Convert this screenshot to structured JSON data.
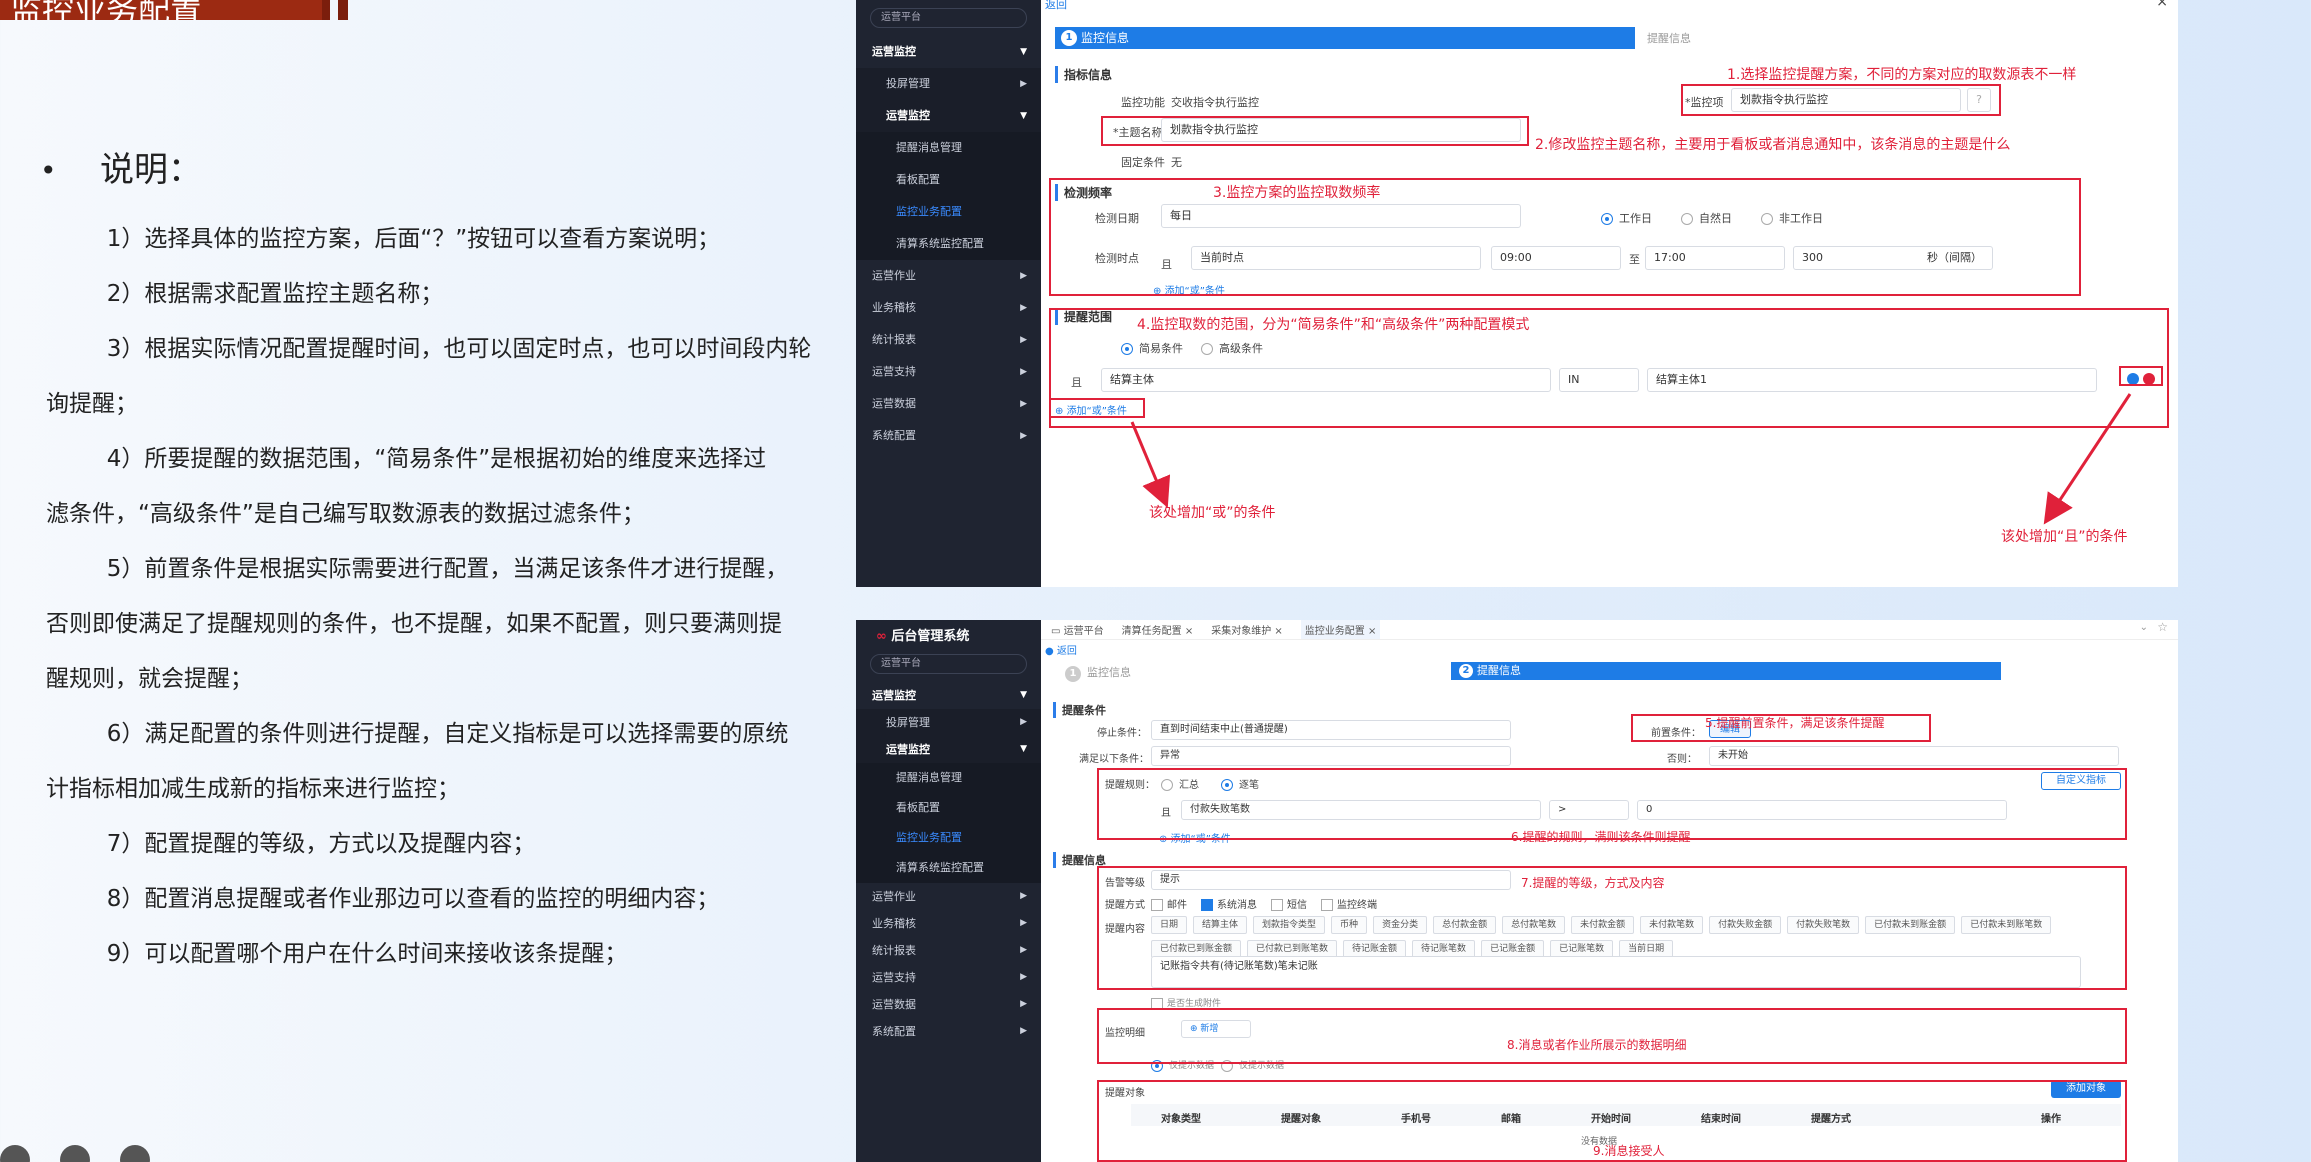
{
  "slide": {
    "title": "监控业务配置",
    "notes_heading": "说明：",
    "bullet": "•",
    "notes": [
      "1）选择具体的监控方案，后面“？”按钮可以查看方案说明；",
      "2）根据需求配置监控主题名称；",
      "3）根据实际情况配置提醒时间，也可以固定时点，也可以时间段内轮",
      "询提醒；",
      "4）所要提醒的数据范围，“简易条件”是根据初始的维度来选择过",
      "滤条件，“高级条件”是自己编写取数源表的数据过滤条件；",
      "5）前置条件是根据实际需要进行配置，当满足该条件才进行提醒，",
      "否则即使满足了提醒规则的条件，也不提醒，如果不配置，则只要满则提",
      "醒规则，就会提醒；",
      "6）满足配置的条件则进行提醒，自定义指标是可以选择需要的原统",
      "计指标相加减生成新的指标来进行监控；",
      "7）配置提醒的等级，方式以及提醒内容；",
      "8）配置消息提醒或者作业那边可以查看的监控的明细内容；",
      "9）可以配置哪个用户在什么时间来接收该条提醒；"
    ]
  },
  "sidebar": {
    "platform": "运营平台",
    "app_name": "后台管理系统",
    "items": [
      {
        "label": "运营监控",
        "level": 0,
        "bold": true
      },
      {
        "label": "投屏管理",
        "level": 1
      },
      {
        "label": "运营监控",
        "level": 1,
        "bold": true
      },
      {
        "label": "提醒消息管理",
        "level": 2
      },
      {
        "label": "看板配置",
        "level": 2
      },
      {
        "label": "监控业务配置",
        "level": 2,
        "active": true
      },
      {
        "label": "清算系统监控配置",
        "level": 2
      },
      {
        "label": "运营作业",
        "level": 0
      },
      {
        "label": "业务稽核",
        "level": 0
      },
      {
        "label": "统计报表",
        "level": 0
      },
      {
        "label": "运营支持",
        "level": 0
      },
      {
        "label": "运营数据",
        "level": 0
      },
      {
        "label": "系统配置",
        "level": 0
      }
    ]
  },
  "top": {
    "back": "返回",
    "step1": "监控信息",
    "step2": "提醒信息",
    "step1_num": "1",
    "step2_num": "2",
    "sec_indicator": "指标信息",
    "label_func": "监控功能",
    "value_func": "交收指令执行监控",
    "label_item": "*监控项",
    "value_item": "划款指令执行监控",
    "label_topic": "*主题名称",
    "value_topic": "划款指令执行监控",
    "label_fixed": "固定条件",
    "value_fixed": "无",
    "sec_freq": "检测频率",
    "label_date": "检测日期",
    "value_date": "每日",
    "opt_work": "工作日",
    "opt_natural": "自然日",
    "opt_nonwork": "非工作日",
    "label_time": "检测时点",
    "and": "且",
    "value_timepoint": "当前时点",
    "time_start": "09:00",
    "to": "至",
    "time_end": "17:00",
    "interval": "300",
    "interval_unit": "秒（间隔）",
    "add_or": "添加“或”条件",
    "sec_range": "提醒范围",
    "opt_simple": "简易条件",
    "opt_advanced": "高级条件",
    "cond_field": "结算主体",
    "cond_op": "IN",
    "cond_value": "结算主体1",
    "annot1": "1.选择监控提醒方案，不同的方案对应的取数源表不一样",
    "annot2": "2.修改监控主题名称，主要用于看板或者消息通知中，该条消息的主题是什么",
    "annot3": "3.监控方案的监控取数频率",
    "annot4": "4.监控取数的范围，分为“简易条件”和“高级条件”两种配置模式",
    "annot_or": "该处增加“或”的条件",
    "annot_and": "该处增加“且”的条件"
  },
  "bottom": {
    "tabs": [
      "运营平台",
      "清算任务配置",
      "采集对象维护",
      "监控业务配置"
    ],
    "back": "返回",
    "step1": "监控信息",
    "step2": "提醒信息",
    "step1_num": "1",
    "step2_num": "2",
    "sec_cond": "提醒条件",
    "label_stop": "停止条件：",
    "value_stop": "直到时间结束中止(普通提醒)",
    "label_pre": "前置条件：",
    "btn_edit": "编辑",
    "label_satisfy": "满足以下条件：",
    "value_satisfy": "异常",
    "label_else": "否则：",
    "value_else": "未开始",
    "label_rule": "提醒规则：",
    "opt_sum": "汇总",
    "opt_each": "逐笔",
    "btn_custom": "自定义指标",
    "and": "且",
    "rule_field": "付款失败笔数",
    "rule_op": ">",
    "rule_value": "0",
    "add_or": "添加“或”条件",
    "sec_info": "提醒信息",
    "label_level": "告警等级",
    "value_level": "提示",
    "label_method": "提醒方式",
    "methods": [
      "邮件",
      "系统消息",
      "短信",
      "监控终端"
    ],
    "label_content": "提醒内容",
    "content_tags": [
      "日期",
      "结算主体",
      "划款指令类型",
      "币种",
      "资金分类",
      "总付款金额",
      "总付款笔数",
      "未付款金额",
      "未付款笔数",
      "付款失败金额",
      "付款失败笔数",
      "已付款未到账金额",
      "已付款未到账笔数",
      "已付款已到账金额",
      "已付款已到账笔数",
      "待记账金额",
      "待记账笔数",
      "已记账金额",
      "已记账笔数",
      "当前日期"
    ],
    "content_text": "记账指令共有(待记账笔数)笔未记账",
    "gen_attach": "是否生成附件",
    "label_detail": "监控明细",
    "btn_new": "新增",
    "detail_opt1": "仅提示数据",
    "detail_opt2": "仅提示数据",
    "label_target": "提醒对象",
    "btn_add_target": "添加对象",
    "cols": [
      "对象类型",
      "提醒对象",
      "手机号",
      "邮箱",
      "开始时间",
      "结束时间",
      "提醒方式",
      "操作"
    ],
    "empty": "没有数据",
    "annot5": "5.提醒前置条件，满足该条件提醒",
    "annot6": "6.提醒的规则，满则该条件则提醒",
    "annot7": "7.提醒的等级，方式及内容",
    "annot8": "8.消息或者作业所展示的数据明细",
    "annot9": "9.消息接受人"
  },
  "icons": {
    "close": "close-icon",
    "plus": "plus-circle-icon",
    "chevron": "chevron-down-icon",
    "star": "star-icon"
  },
  "colors": {
    "accent": "#1e7ce6",
    "annotation": "#e0213a",
    "sidebar": "#1f2431",
    "title_bar": "#9c2a12"
  }
}
